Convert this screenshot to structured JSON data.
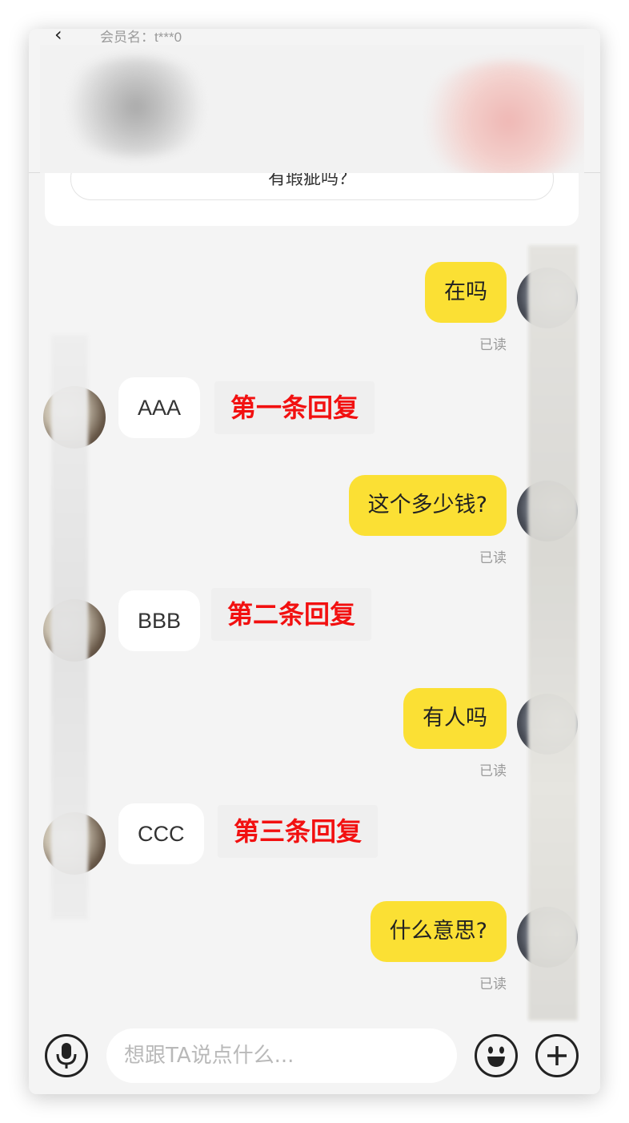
{
  "header": {
    "member_label": "会员名：t***0"
  },
  "question_card": {
    "text": "有瑕疵吗？"
  },
  "messages": [
    {
      "direction": "out",
      "text": "在吗",
      "status": "已读"
    },
    {
      "direction": "in",
      "text": "AAA",
      "annotation": "第一条回复"
    },
    {
      "direction": "out",
      "text": "这个多少钱?",
      "status": "已读"
    },
    {
      "direction": "in",
      "text": "BBB",
      "annotation": "第二条回复"
    },
    {
      "direction": "out",
      "text": "有人吗",
      "status": "已读"
    },
    {
      "direction": "in",
      "text": "CCC",
      "annotation": "第三条回复"
    },
    {
      "direction": "out",
      "text": "什么意思?",
      "status": "已读"
    }
  ],
  "input_bar": {
    "placeholder": "想跟TA说点什么...",
    "icons": [
      "microphone-icon",
      "emoji-icon",
      "plus-icon"
    ]
  },
  "colors": {
    "outgoing_bubble": "#fbe034",
    "incoming_bubble": "#ffffff",
    "annotation_text": "#f21010",
    "background": "#f4f4f4"
  }
}
